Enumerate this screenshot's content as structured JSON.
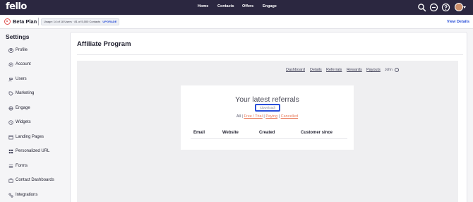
{
  "topbar": {
    "logo": "fello",
    "nav": [
      "Home",
      "Contacts",
      "Offers",
      "Engage"
    ],
    "icons": [
      "search-icon",
      "add-circle-icon",
      "help-icon",
      "avatar"
    ]
  },
  "planbar": {
    "plan_name": "Beta Plan",
    "usage_text": "Usage: 14 of 18 Users · 81 of 5,000 Contacts",
    "upgrade_label": "UPGRADE",
    "view_details": "View Details"
  },
  "sidebar": {
    "title": "Settings",
    "items": [
      {
        "label": "Profile",
        "icon": "user-circle-icon"
      },
      {
        "label": "Account",
        "icon": "gear-icon"
      },
      {
        "label": "Users",
        "icon": "users-icon"
      },
      {
        "label": "Marketing",
        "icon": "tag-icon"
      },
      {
        "label": "Engage",
        "icon": "engage-icon"
      },
      {
        "label": "Widgets",
        "icon": "widget-icon"
      },
      {
        "label": "Landing Pages",
        "icon": "page-icon"
      },
      {
        "label": "Personalized URL",
        "icon": "grid-icon"
      },
      {
        "label": "Forms",
        "icon": "list-icon"
      },
      {
        "label": "Contact Dashboards",
        "icon": "dashboard-icon"
      },
      {
        "label": "Integrations",
        "icon": "integrations-icon"
      }
    ]
  },
  "main": {
    "title": "Affiliate Program",
    "tabs": [
      "Dashboard",
      "Details",
      "Referrals",
      "Rewards",
      "Payouts"
    ],
    "user": "John",
    "card": {
      "title": "Your latest referrals",
      "download_label": "(download)",
      "filters": [
        "All",
        "Free / Trial",
        "Paying",
        "Cancelled"
      ],
      "columns": [
        "Email",
        "Website",
        "Created",
        "Customer since"
      ]
    }
  },
  "colors": {
    "topbar": "#2b2740",
    "accent": "#2a4fd8",
    "filter_link": "#e87a5a"
  }
}
